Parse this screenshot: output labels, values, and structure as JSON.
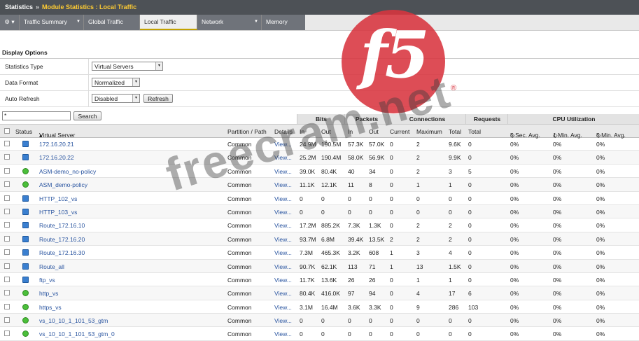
{
  "breadcrumb": {
    "root": "Statistics",
    "separator": "»",
    "current": "Module Statistics : Local Traffic"
  },
  "tabs": [
    {
      "label": "Traffic Summary",
      "dropdown": true
    },
    {
      "label": "Global Traffic",
      "dropdown": false
    },
    {
      "label": "Local Traffic",
      "dropdown": false,
      "active": true
    },
    {
      "label": "Network",
      "dropdown": true
    },
    {
      "label": "Memory",
      "dropdown": false
    }
  ],
  "display_options": {
    "title": "Display Options",
    "statistics_type": {
      "label": "Statistics Type",
      "value": "Virtual Servers"
    },
    "data_format": {
      "label": "Data Format",
      "value": "Normalized"
    },
    "auto_refresh": {
      "label": "Auto Refresh",
      "value": "Disabled",
      "button": "Refresh"
    }
  },
  "search": {
    "value": "*",
    "button": "Search"
  },
  "groups": {
    "bits": "Bits",
    "packets": "Packets",
    "connections": "Connections",
    "requests": "Requests",
    "cpu": "CPU Utilization"
  },
  "columns": {
    "status": "Status",
    "name": "Virtual Server",
    "partition": "Partition / Path",
    "details": "Details",
    "bits_in": "In",
    "bits_out": "Out",
    "pk_in": "In",
    "pk_out": "Out",
    "conn_current": "Current",
    "conn_max": "Maximum",
    "conn_total": "Total",
    "req_total": "Total",
    "cpu5s": "5 Sec. Avg.",
    "cpu1m": "1 Min. Avg.",
    "cpu5m": "5 Min. Avg."
  },
  "rows": [
    {
      "status": "blue",
      "name": "172.16.20.21",
      "partition": "Common",
      "details": "View...",
      "bits_in": "24.9M",
      "bits_out": "190.5M",
      "pk_in": "57.3K",
      "pk_out": "57.0K",
      "cur": "0",
      "max": "2",
      "total": "9.6K",
      "req": "0",
      "c5s": "0%",
      "c1m": "0%",
      "c5m": "0%"
    },
    {
      "status": "blue",
      "name": "172.16.20.22",
      "partition": "Common",
      "details": "View...",
      "bits_in": "25.2M",
      "bits_out": "190.4M",
      "pk_in": "58.0K",
      "pk_out": "56.9K",
      "cur": "0",
      "max": "2",
      "total": "9.9K",
      "req": "0",
      "c5s": "0%",
      "c1m": "0%",
      "c5m": "0%"
    },
    {
      "status": "green",
      "name": "ASM-demo_no-policy",
      "partition": "Common",
      "details": "View...",
      "bits_in": "39.0K",
      "bits_out": "80.4K",
      "pk_in": "40",
      "pk_out": "34",
      "cur": "0",
      "max": "2",
      "total": "3",
      "req": "5",
      "c5s": "0%",
      "c1m": "0%",
      "c5m": "0%"
    },
    {
      "status": "green",
      "name": "ASM_demo-policy",
      "partition": "Common",
      "details": "View...",
      "bits_in": "11.1K",
      "bits_out": "12.1K",
      "pk_in": "11",
      "pk_out": "8",
      "cur": "0",
      "max": "1",
      "total": "1",
      "req": "0",
      "c5s": "0%",
      "c1m": "0%",
      "c5m": "0%"
    },
    {
      "status": "blue",
      "name": "HTTP_102_vs",
      "partition": "Common",
      "details": "View...",
      "bits_in": "0",
      "bits_out": "0",
      "pk_in": "0",
      "pk_out": "0",
      "cur": "0",
      "max": "0",
      "total": "0",
      "req": "0",
      "c5s": "0%",
      "c1m": "0%",
      "c5m": "0%"
    },
    {
      "status": "blue",
      "name": "HTTP_103_vs",
      "partition": "Common",
      "details": "View...",
      "bits_in": "0",
      "bits_out": "0",
      "pk_in": "0",
      "pk_out": "0",
      "cur": "0",
      "max": "0",
      "total": "0",
      "req": "0",
      "c5s": "0%",
      "c1m": "0%",
      "c5m": "0%"
    },
    {
      "status": "blue",
      "name": "Route_172.16.10",
      "partition": "Common",
      "details": "View...",
      "bits_in": "17.2M",
      "bits_out": "885.2K",
      "pk_in": "7.3K",
      "pk_out": "1.3K",
      "cur": "0",
      "max": "2",
      "total": "2",
      "req": "0",
      "c5s": "0%",
      "c1m": "0%",
      "c5m": "0%"
    },
    {
      "status": "blue",
      "name": "Route_172.16.20",
      "partition": "Common",
      "details": "View...",
      "bits_in": "93.7M",
      "bits_out": "6.8M",
      "pk_in": "39.4K",
      "pk_out": "13.5K",
      "cur": "2",
      "max": "2",
      "total": "2",
      "req": "0",
      "c5s": "0%",
      "c1m": "0%",
      "c5m": "0%"
    },
    {
      "status": "blue",
      "name": "Route_172.16.30",
      "partition": "Common",
      "details": "View...",
      "bits_in": "7.3M",
      "bits_out": "465.3K",
      "pk_in": "3.2K",
      "pk_out": "608",
      "cur": "1",
      "max": "3",
      "total": "4",
      "req": "0",
      "c5s": "0%",
      "c1m": "0%",
      "c5m": "0%"
    },
    {
      "status": "blue",
      "name": "Route_all",
      "partition": "Common",
      "details": "View...",
      "bits_in": "90.7K",
      "bits_out": "62.1K",
      "pk_in": "113",
      "pk_out": "71",
      "cur": "1",
      "max": "13",
      "total": "1.5K",
      "req": "0",
      "c5s": "0%",
      "c1m": "0%",
      "c5m": "0%"
    },
    {
      "status": "blue",
      "name": "ftp_vs",
      "partition": "Common",
      "details": "View...",
      "bits_in": "11.7K",
      "bits_out": "13.6K",
      "pk_in": "26",
      "pk_out": "26",
      "cur": "0",
      "max": "1",
      "total": "1",
      "req": "0",
      "c5s": "0%",
      "c1m": "0%",
      "c5m": "0%"
    },
    {
      "status": "green",
      "name": "http_vs",
      "partition": "Common",
      "details": "View...",
      "bits_in": "80.4K",
      "bits_out": "416.0K",
      "pk_in": "97",
      "pk_out": "94",
      "cur": "0",
      "max": "4",
      "total": "17",
      "req": "6",
      "c5s": "0%",
      "c1m": "0%",
      "c5m": "0%"
    },
    {
      "status": "green",
      "name": "https_vs",
      "partition": "Common",
      "details": "View...",
      "bits_in": "3.1M",
      "bits_out": "16.4M",
      "pk_in": "3.6K",
      "pk_out": "3.3K",
      "cur": "0",
      "max": "9",
      "total": "286",
      "req": "103",
      "c5s": "0%",
      "c1m": "0%",
      "c5m": "0%"
    },
    {
      "status": "green",
      "name": "vs_10_10_1_101_53_gtm",
      "partition": "Common",
      "details": "View...",
      "bits_in": "0",
      "bits_out": "0",
      "pk_in": "0",
      "pk_out": "0",
      "cur": "0",
      "max": "0",
      "total": "0",
      "req": "0",
      "c5s": "0%",
      "c1m": "0%",
      "c5m": "0%"
    },
    {
      "status": "green",
      "name": "vs_10_10_1_101_53_gtm_0",
      "partition": "Common",
      "details": "View...",
      "bits_in": "0",
      "bits_out": "0",
      "pk_in": "0",
      "pk_out": "0",
      "cur": "0",
      "max": "0",
      "total": "0",
      "req": "0",
      "c5s": "0%",
      "c1m": "0%",
      "c5m": "0%"
    }
  ],
  "overlay": {
    "watermark": "freecram.net",
    "logo": "f5",
    "registered": "®"
  },
  "colors": {
    "topbar": "#4d5156",
    "tab_bg": "#6f737a",
    "crumb_current": "#ffcc33",
    "link": "#2a55a0",
    "status_blue": "#3a7fd0",
    "status_green": "#4bbf3a",
    "logo_red": "#d9353f"
  }
}
